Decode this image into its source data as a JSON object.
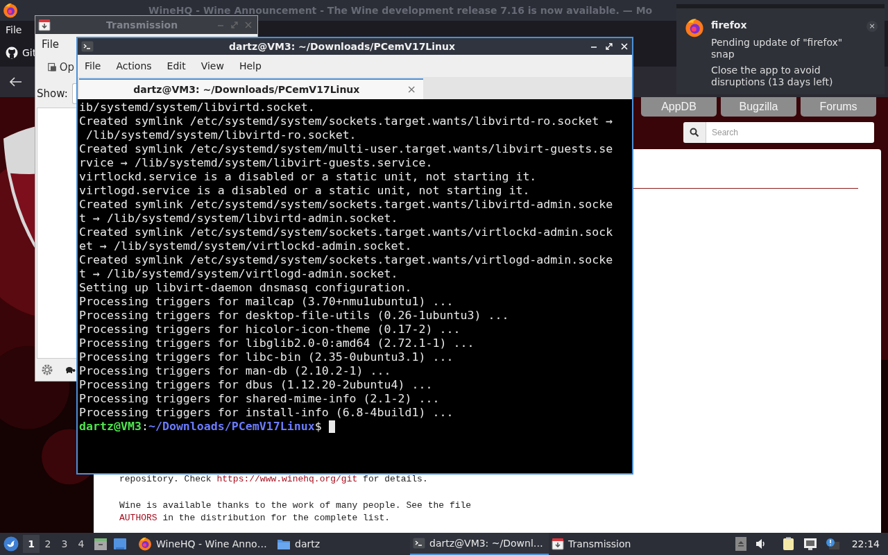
{
  "browser": {
    "title": "WineHQ - Wine Announcement - The Wine development release 7.16 is now available. — Mo",
    "menu": [
      "File"
    ],
    "tab": "Git",
    "nav_buttons": [
      "AppDB",
      "Bugzilla",
      "Forums"
    ],
    "search": {
      "placeholder": "Search"
    },
    "page_lines": [
      [
        {
          "kind": "text",
          "text": "repository. Check "
        },
        {
          "kind": "link",
          "text": "https://www.winehq.org/git"
        },
        {
          "kind": "text",
          "text": " for details."
        }
      ],
      [
        {
          "kind": "gap"
        },
        {
          "kind": "text",
          "text": "Wine is available thanks to the work of many people. See the file"
        }
      ],
      [
        {
          "kind": "link",
          "text": "AUTHORS"
        },
        {
          "kind": "text",
          "text": " in the distribution for the complete list."
        }
      ]
    ]
  },
  "transmission": {
    "title": "Transmission",
    "menu": [
      "File"
    ],
    "toolbar": "Op",
    "show_label": "Show:"
  },
  "terminal": {
    "title": "dartz@VM3: ~/Downloads/PCemV17Linux",
    "menu": [
      "File",
      "Actions",
      "Edit",
      "View",
      "Help"
    ],
    "tab": {
      "label": "dartz@VM3: ~/Downloads/PCemV17Linux",
      "selected": true,
      "close": "×"
    },
    "lines": [
      "ib/systemd/system/libvirtd.socket.",
      "Created symlink /etc/systemd/system/sockets.target.wants/libvirtd-ro.socket →",
      " /lib/systemd/system/libvirtd-ro.socket.",
      "Created symlink /etc/systemd/system/multi-user.target.wants/libvirt-guests.se",
      "rvice → /lib/systemd/system/libvirt-guests.service.",
      "virtlockd.service is a disabled or a static unit, not starting it.",
      "virtlogd.service is a disabled or a static unit, not starting it.",
      "Created symlink /etc/systemd/system/sockets.target.wants/libvirtd-admin.socke",
      "t → /lib/systemd/system/libvirtd-admin.socket.",
      "Created symlink /etc/systemd/system/sockets.target.wants/virtlockd-admin.sock",
      "et → /lib/systemd/system/virtlockd-admin.socket.",
      "Created symlink /etc/systemd/system/sockets.target.wants/virtlogd-admin.socke",
      "t → /lib/systemd/system/virtlogd-admin.socket.",
      "Setting up libvirt-daemon dnsmasq configuration.",
      "Processing triggers for mailcap (3.70+nmu1ubuntu1) ...",
      "Processing triggers for desktop-file-utils (0.26-1ubuntu3) ...",
      "Processing triggers for hicolor-icon-theme (0.17-2) ...",
      "Processing triggers for libglib2.0-0:amd64 (2.72.1-1) ...",
      "Processing triggers for libc-bin (2.35-0ubuntu3.1) ...",
      "Processing triggers for man-db (2.10.2-1) ...",
      "Processing triggers for dbus (1.12.20-2ubuntu4) ...",
      "Processing triggers for shared-mime-info (2.1-2) ...",
      "Processing triggers for install-info (6.8-4build1) ..."
    ],
    "prompt": {
      "user": "dartz@VM3",
      "separator": ":",
      "path": "~/Downloads/PCemV17Linux",
      "symbol": "$"
    }
  },
  "notification": {
    "app": "firefox",
    "summary": "Pending update of \"firefox\" snap",
    "body": "Close the app to avoid disruptions (13 days left)",
    "close": "×"
  },
  "taskbar": {
    "workspaces": [
      {
        "label": "1",
        "selected": true
      },
      {
        "label": "2",
        "selected": false
      },
      {
        "label": "3",
        "selected": false
      },
      {
        "label": "4",
        "selected": false
      }
    ],
    "tasks": [
      {
        "kind": "browser",
        "label": "WineHQ - Wine Anno…",
        "selected": false
      },
      {
        "kind": "folder",
        "label": "dartz",
        "selected": false
      },
      {
        "kind": "terminal",
        "label": "dartz@VM3: ~/Downl…",
        "selected": true
      },
      {
        "kind": "transmission",
        "label": "Transmission",
        "selected": false
      }
    ],
    "clock": "22:14"
  }
}
